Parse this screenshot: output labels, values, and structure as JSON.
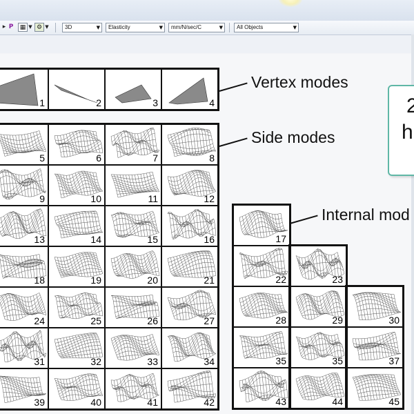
{
  "toolbar": {
    "icons": [
      "pin-icon",
      "grid-icon",
      "gear-icon"
    ],
    "dropdowns": {
      "view": "3D",
      "analysis": "Elasticity",
      "units": "mm/N/sec/C",
      "filter": "All Objects"
    },
    "p_glyph": "P"
  },
  "figure": {
    "labels": {
      "vertex": "Vertex modes",
      "side": "Side modes",
      "internal": "Internal mod"
    },
    "callout": {
      "line1": "2",
      "line2": "h"
    },
    "vertex_modes": [
      "1",
      "2",
      "3",
      "4"
    ],
    "side_modes": [
      [
        "5",
        "6",
        "7",
        "8"
      ],
      [
        "9",
        "10",
        "11",
        "12"
      ],
      [
        "13",
        "14",
        "15",
        "16"
      ],
      [
        "18",
        "19",
        "20",
        "21"
      ],
      [
        "24",
        "25",
        "26",
        "27"
      ],
      [
        "31",
        "32",
        "33",
        "34"
      ],
      [
        "39",
        "40",
        "41",
        "42"
      ]
    ],
    "internal_modes": [
      [
        "17"
      ],
      [
        "22",
        "23"
      ],
      [
        "28",
        "29",
        "30"
      ],
      [
        "35",
        "35",
        "37"
      ],
      [
        "43",
        "44",
        "45"
      ]
    ]
  }
}
